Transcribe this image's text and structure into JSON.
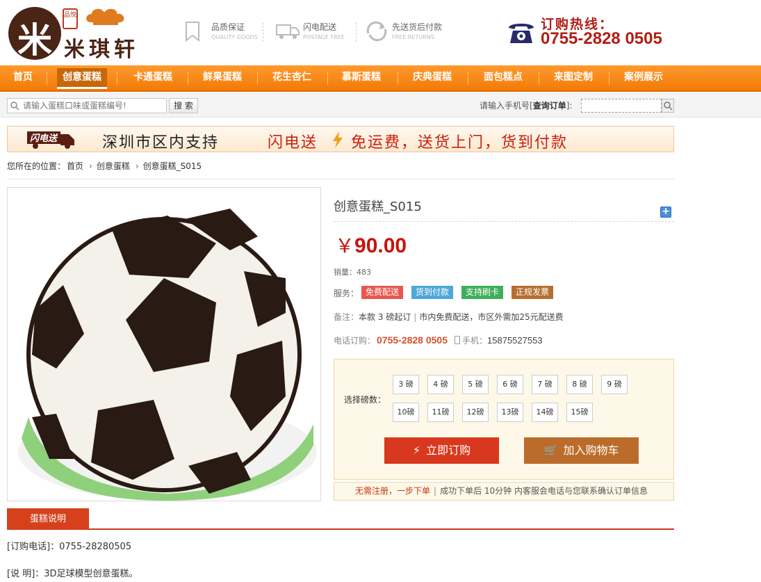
{
  "logo": {
    "glyph": "米",
    "stamp": "品悦",
    "name": "米琪轩"
  },
  "features": [
    {
      "title": "品质保证",
      "subtitle": "QUALITY GOODS",
      "icon": "bookmark-icon"
    },
    {
      "title": "闪电配送",
      "subtitle": "POSTAGE FREE",
      "icon": "truck-icon"
    },
    {
      "title": "先送货后付款",
      "subtitle": "FREE RETURNS",
      "icon": "return-icon"
    }
  ],
  "hotline": {
    "label": "订购热线：",
    "number": "0755-2828 0505"
  },
  "nav": {
    "items": [
      {
        "label": "首页"
      },
      {
        "label": "创意蛋糕"
      },
      {
        "label": "卡通蛋糕"
      },
      {
        "label": "鲜果蛋糕"
      },
      {
        "label": "花生杏仁"
      },
      {
        "label": "慕斯蛋糕"
      },
      {
        "label": "庆典蛋糕"
      },
      {
        "label": "面包糕点"
      },
      {
        "label": "来图定制"
      },
      {
        "label": "案例展示"
      }
    ],
    "active_index": 1
  },
  "search": {
    "placeholder": "请输入蛋糕口味或蛋糕编号!",
    "button": "搜 索",
    "query_label_prefix": "请输入手机号[",
    "query_label_bold": "查询订单",
    "query_label_suffix": "]:"
  },
  "banner": {
    "badge": "闪电送",
    "text1": "深圳市区内支持",
    "text2": "闪电送",
    "text3": "免运费，送货上门，货到付款"
  },
  "breadcrumb": {
    "prefix": "您所在的位置：",
    "items": [
      "首页",
      "创意蛋糕",
      "创意蛋糕_S015"
    ],
    "separator": "›"
  },
  "product": {
    "title": "创意蛋糕_S015",
    "currency": "￥",
    "price": "90.00",
    "sales_label": "销量：",
    "sales": "483",
    "services_label": "服务：",
    "services": [
      {
        "label": "免费配送",
        "color": "#e8584f"
      },
      {
        "label": "货到付款",
        "color": "#4fa6d8"
      },
      {
        "label": "支持刷卡",
        "color": "#3fae5a"
      },
      {
        "label": "正规发票",
        "color": "#b56e2e"
      }
    ],
    "note_label": "备注：",
    "note_part1": "本款 3 磅起订",
    "note_sep": "|",
    "note_part2": "市内免费配送，市区外需加25元配送费",
    "tel_label": "电话订购：",
    "tel": "0755-2828 0505",
    "mobile_label": "手机：",
    "mobile": "15875527553"
  },
  "weight_select": {
    "label": "选择磅数：",
    "row1": [
      "3 磅",
      "4 磅",
      "5 磅",
      "6 磅",
      "7 磅",
      "8 磅",
      "9 磅"
    ],
    "row2": [
      "10磅",
      "11磅",
      "12磅",
      "13磅",
      "14磅",
      "15磅"
    ]
  },
  "actions": {
    "order": "立即订购",
    "cart": "加入购物车"
  },
  "tip": {
    "highlight": "无需注册，一步下单",
    "sep": "|",
    "text": "成功下单后 10分钟 内客服会电话与您联系确认订单信息"
  },
  "description": {
    "tab": "蛋糕说明",
    "line1": "[订购电话]：0755-28280505",
    "line2": "[说 明]：3D足球模型创意蛋糕。"
  },
  "colors": {
    "brand_orange": "#f37a05",
    "price_red": "#c8140a",
    "hotline_red": "#b01e14"
  }
}
